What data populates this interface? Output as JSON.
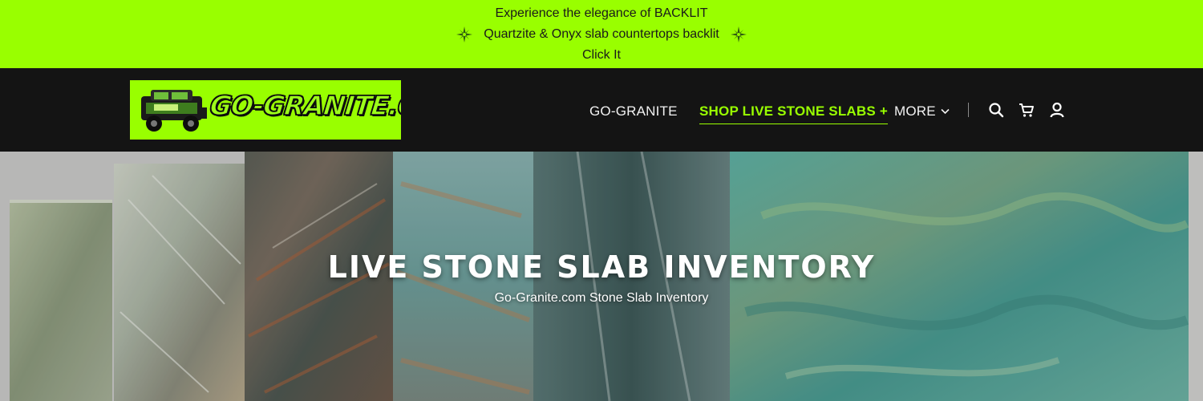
{
  "announcement": {
    "line1": "Experience the elegance of BACKLIT",
    "line2": "Quartzite & Onyx slab countertops backlit",
    "line3": "Click It",
    "sparkle_icon": "sparkle-icon"
  },
  "header": {
    "logo_text": "GO-GRANITE.COM",
    "nav": {
      "home": "GO-GRANITE",
      "shop": "SHOP LIVE STONE SLABS +",
      "more": "MORE"
    },
    "icons": [
      "search-icon",
      "cart-icon",
      "account-icon"
    ]
  },
  "hero": {
    "title": "LIVE STONE SLAB INVENTORY",
    "subtitle": "Go-Granite.com Stone Slab Inventory"
  },
  "colors": {
    "accent": "#99ff00",
    "header_bg": "#141414",
    "nav_text": "#f2f2f2"
  }
}
